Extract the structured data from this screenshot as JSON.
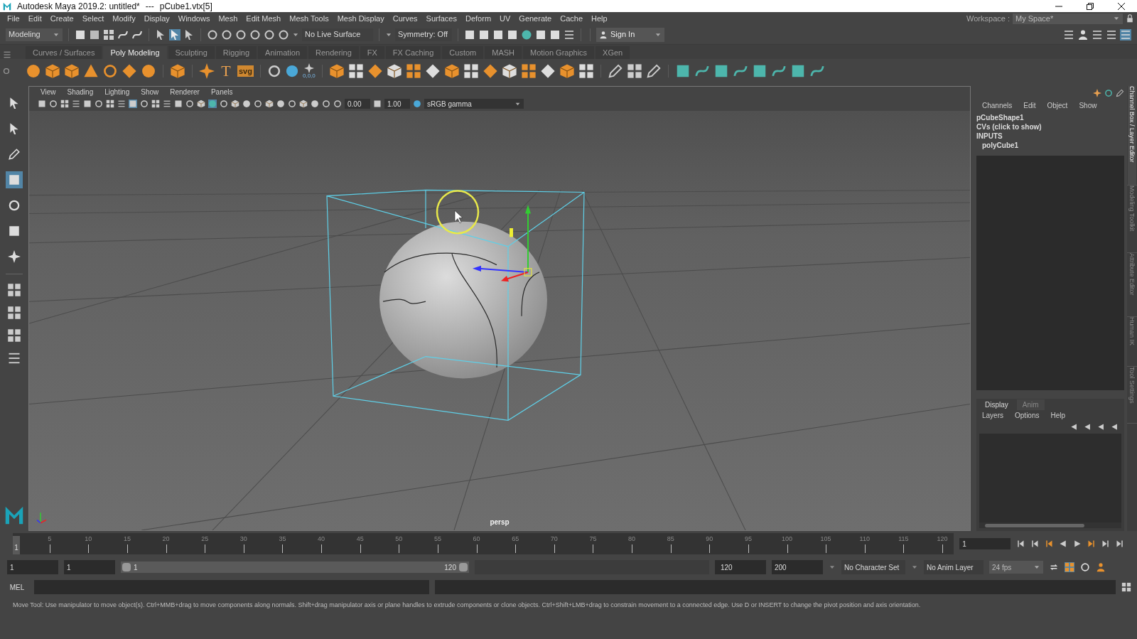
{
  "title_bar": {
    "app": "Autodesk Maya 2019.2: untitled*",
    "separator": "---",
    "selection": "pCube1.vtx[5]"
  },
  "menu_bar": [
    "File",
    "Edit",
    "Create",
    "Select",
    "Modify",
    "Display",
    "Windows",
    "Mesh",
    "Edit Mesh",
    "Mesh Tools",
    "Mesh Display",
    "Curves",
    "Surfaces",
    "Deform",
    "UV",
    "Generate",
    "Cache",
    "Help"
  ],
  "workspace": {
    "label": "Workspace :",
    "value": "My Space*"
  },
  "status_line": {
    "menu_set": "Modeling",
    "live_surface": "No Live Surface",
    "symmetry": "Symmetry: Off",
    "sign_in": "Sign In"
  },
  "shelf_tabs": [
    {
      "label": "Curves / Surfaces",
      "selected": false
    },
    {
      "label": "Poly Modeling",
      "selected": true
    },
    {
      "label": "Sculpting",
      "selected": false
    },
    {
      "label": "Rigging",
      "selected": false
    },
    {
      "label": "Animation",
      "selected": false
    },
    {
      "label": "Rendering",
      "selected": false
    },
    {
      "label": "FX",
      "selected": false
    },
    {
      "label": "FX Caching",
      "selected": false
    },
    {
      "label": "Custom",
      "selected": false
    },
    {
      "label": "MASH",
      "selected": false
    },
    {
      "label": "Motion Graphics",
      "selected": false
    },
    {
      "label": "XGen",
      "selected": false
    }
  ],
  "shelf_labels": {
    "text_tool": "T",
    "svg_tool": "svg",
    "pivot_readout": "0,0,0"
  },
  "toolbox": [
    {
      "selected": false
    },
    {
      "selected": false
    },
    {
      "selected": false
    },
    {
      "selected": true
    },
    {
      "selected": false
    },
    {
      "selected": false
    },
    {
      "selected": false
    }
  ],
  "viewport": {
    "menus": [
      "View",
      "Shading",
      "Lighting",
      "Show",
      "Renderer",
      "Panels"
    ],
    "exposure": "0.00",
    "gamma": "1.00",
    "color_space": "sRGB gamma",
    "camera": "persp"
  },
  "channel_box": {
    "menus": [
      "Channels",
      "Edit",
      "Object",
      "Show"
    ],
    "shape": "pCubeShape1",
    "cvs": "CVs (click to show)",
    "inputs": {
      "label": "INPUTS",
      "children": [
        "polyCube1"
      ]
    }
  },
  "layer_editor": {
    "tabs": [
      {
        "label": "Display",
        "selected": true
      },
      {
        "label": "Anim",
        "selected": false
      }
    ],
    "menus": [
      "Layers",
      "Options",
      "Help"
    ]
  },
  "side_tabs": [
    {
      "label": "Channel Box / Layer Editor",
      "selected": true
    },
    {
      "label": "Modeling Toolkit",
      "selected": false
    },
    {
      "label": "Attribute Editor",
      "selected": false
    },
    {
      "label": "Human IK",
      "selected": false
    },
    {
      "label": "Tool Settings",
      "selected": false
    }
  ],
  "time_slider": {
    "ticks": [
      "5",
      "10",
      "15",
      "20",
      "25",
      "30",
      "35",
      "40",
      "45",
      "50",
      "55",
      "60",
      "65",
      "70",
      "75",
      "80",
      "85",
      "90",
      "95",
      "100",
      "105",
      "110",
      "115",
      "120"
    ],
    "current_frame": "1",
    "level": 0,
    "frame_field": "1"
  },
  "range_slider": {
    "start": "1",
    "playback_start": "1",
    "range_start": "1",
    "range_end": "120",
    "level": 1,
    "playback_end": "120",
    "end": "200",
    "character_set": "No Character Set",
    "anim_layer": "No Anim Layer",
    "fps": "24 fps"
  },
  "command_line": {
    "label": "MEL"
  },
  "help_line": "Move Tool: Use manipulator to move object(s). Ctrl+MMB+drag to move components along normals. Shift+drag manipulator axis or plane handles to extrude components or clone objects. Ctrl+Shift+LMB+drag to constrain movement to a connected edge. Use D or INSERT to change the pivot position and axis orientation."
}
